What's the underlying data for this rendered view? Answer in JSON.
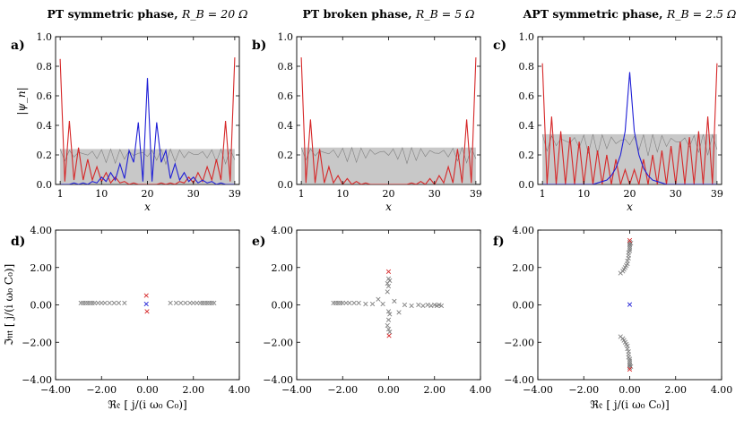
{
  "colors": {
    "red": "#d62728",
    "blue": "#1f1fd6",
    "gray": "#7f7f7f",
    "bulk_fill": "#9a9a9a"
  },
  "chart_data": [
    {
      "id": "a",
      "type": "line",
      "panel_label": "a)",
      "title": "PT symmetric phase, R_B = 20 Ω",
      "title_main": "PT symmetric phase, ",
      "title_math": "R_B = 20 Ω",
      "xlabel": "x",
      "ylabel": "|ψ_n|",
      "xlim": [
        0,
        40
      ],
      "ylim": [
        0,
        1
      ],
      "xticks": [
        1,
        10,
        20,
        30,
        39
      ],
      "yticks": [
        "0.0",
        "0.2",
        "0.4",
        "0.6",
        "0.8",
        "1.0"
      ],
      "bulk_band": {
        "color": "gray",
        "range": [
          0.0,
          0.24
        ]
      },
      "series": [
        {
          "color": "red",
          "x": [
            1,
            2,
            3,
            4,
            5,
            6,
            7,
            8,
            9,
            10,
            11,
            12,
            13,
            14,
            15,
            16,
            17,
            18,
            19,
            20,
            21,
            22,
            23,
            24,
            25,
            26,
            27,
            28,
            29,
            30,
            31,
            32,
            33,
            34,
            35,
            36,
            37,
            38,
            39
          ],
          "values": [
            0.85,
            0.02,
            0.43,
            0.03,
            0.25,
            0.03,
            0.17,
            0.03,
            0.12,
            0.02,
            0.08,
            0.01,
            0.05,
            0.01,
            0.02,
            0.0,
            0.01,
            0.0,
            0.0,
            0.0,
            0.0,
            0.0,
            0.01,
            0.0,
            0.01,
            0.0,
            0.02,
            0.01,
            0.05,
            0.01,
            0.08,
            0.02,
            0.12,
            0.03,
            0.17,
            0.03,
            0.43,
            0.02,
            0.86
          ]
        },
        {
          "color": "blue",
          "x": [
            1,
            2,
            3,
            4,
            5,
            6,
            7,
            8,
            9,
            10,
            11,
            12,
            13,
            14,
            15,
            16,
            17,
            18,
            19,
            20,
            21,
            22,
            23,
            24,
            25,
            26,
            27,
            28,
            29,
            30,
            31,
            32,
            33,
            34,
            35,
            36,
            37,
            38,
            39
          ],
          "values": [
            0.0,
            0.0,
            0.0,
            0.01,
            0.0,
            0.01,
            0.0,
            0.02,
            0.01,
            0.05,
            0.02,
            0.08,
            0.03,
            0.14,
            0.04,
            0.23,
            0.15,
            0.42,
            0.02,
            0.72,
            0.02,
            0.42,
            0.15,
            0.23,
            0.04,
            0.14,
            0.03,
            0.08,
            0.02,
            0.05,
            0.01,
            0.03,
            0.01,
            0.02,
            0.0,
            0.01,
            0.0,
            0.0,
            0.0
          ]
        }
      ]
    },
    {
      "id": "b",
      "type": "line",
      "panel_label": "b)",
      "title": "PT broken phase, R_B = 5 Ω",
      "title_main": "PT broken phase, ",
      "title_math": "R_B = 5 Ω",
      "xlabel": "x",
      "ylabel": "",
      "xlim": [
        0,
        40
      ],
      "ylim": [
        0,
        1
      ],
      "xticks": [
        1,
        10,
        20,
        30,
        39
      ],
      "yticks": [
        "0.0",
        "0.2",
        "0.4",
        "0.6",
        "0.8",
        "1.0"
      ],
      "bulk_band": {
        "color": "gray",
        "range": [
          0.0,
          0.25
        ]
      },
      "series": [
        {
          "color": "red",
          "x": [
            1,
            2,
            3,
            4,
            5,
            6,
            7,
            8,
            9,
            10,
            11,
            12,
            13,
            14,
            15,
            16,
            17,
            18,
            19,
            20,
            21,
            22,
            23,
            24,
            25,
            26,
            27,
            28,
            29,
            30,
            31,
            32,
            33,
            34,
            35,
            36,
            37,
            38,
            39
          ],
          "values": [
            0.86,
            0.01,
            0.44,
            0.01,
            0.24,
            0.01,
            0.12,
            0.01,
            0.06,
            0.0,
            0.04,
            0.0,
            0.02,
            0.0,
            0.01,
            0.0,
            0.0,
            0.0,
            0.0,
            0.0,
            0.0,
            0.0,
            0.0,
            0.0,
            0.01,
            0.0,
            0.02,
            0.0,
            0.04,
            0.0,
            0.06,
            0.01,
            0.12,
            0.01,
            0.24,
            0.01,
            0.44,
            0.01,
            0.86
          ]
        }
      ]
    },
    {
      "id": "c",
      "type": "line",
      "panel_label": "c)",
      "title": "APT symmetric phase, R_B = 2.5 Ω",
      "title_main": "APT symmetric phase, ",
      "title_math": "R_B = 2.5 Ω",
      "xlabel": "x",
      "ylabel": "",
      "xlim": [
        0,
        40
      ],
      "ylim": [
        0,
        1
      ],
      "xticks": [
        1,
        10,
        20,
        30,
        39
      ],
      "yticks": [
        "0.0",
        "0.2",
        "0.4",
        "0.6",
        "0.8",
        "1.0"
      ],
      "bulk_band": {
        "color": "gray",
        "range": [
          0.0,
          0.34
        ]
      },
      "series": [
        {
          "color": "red",
          "x": [
            1,
            2,
            3,
            4,
            5,
            6,
            7,
            8,
            9,
            10,
            11,
            12,
            13,
            14,
            15,
            16,
            17,
            18,
            19,
            20,
            21,
            22,
            23,
            24,
            25,
            26,
            27,
            28,
            29,
            30,
            31,
            32,
            33,
            34,
            35,
            36,
            37,
            38,
            39
          ],
          "values": [
            0.82,
            0.0,
            0.46,
            0.0,
            0.36,
            0.0,
            0.32,
            0.0,
            0.29,
            0.0,
            0.26,
            0.0,
            0.23,
            0.0,
            0.2,
            0.0,
            0.17,
            0.0,
            0.1,
            0.0,
            0.1,
            0.0,
            0.17,
            0.0,
            0.2,
            0.0,
            0.23,
            0.0,
            0.26,
            0.0,
            0.29,
            0.0,
            0.32,
            0.0,
            0.36,
            0.0,
            0.46,
            0.0,
            0.82
          ]
        },
        {
          "color": "blue",
          "x": [
            1,
            2,
            3,
            4,
            5,
            6,
            7,
            8,
            9,
            10,
            11,
            12,
            13,
            14,
            15,
            16,
            17,
            18,
            19,
            20,
            21,
            22,
            23,
            24,
            25,
            26,
            27,
            28,
            29,
            30,
            31,
            32,
            33,
            34,
            35,
            36,
            37,
            38,
            39
          ],
          "values": [
            0.0,
            0.0,
            0.0,
            0.0,
            0.0,
            0.0,
            0.0,
            0.0,
            0.0,
            0.0,
            0.0,
            0.0,
            0.01,
            0.02,
            0.03,
            0.06,
            0.11,
            0.2,
            0.36,
            0.76,
            0.36,
            0.2,
            0.11,
            0.06,
            0.03,
            0.02,
            0.01,
            0.0,
            0.0,
            0.0,
            0.0,
            0.0,
            0.0,
            0.0,
            0.0,
            0.0,
            0.0,
            0.0,
            0.0
          ]
        }
      ]
    },
    {
      "id": "d",
      "type": "scatter",
      "panel_label": "d)",
      "xlabel": "ℜ𝔢 [ j/(i ω₀ C₀)]",
      "ylabel": "ℑ𝔪 [ j/(i ω₀ C₀)]",
      "xlim": [
        -4,
        4
      ],
      "ylim": [
        -4,
        4
      ],
      "xticks": [
        "−4.00",
        "−2.00",
        "0.00",
        "2.00",
        "4.00"
      ],
      "yticks": [
        "−4.00",
        "−2.00",
        "0.00",
        "2.00",
        "4.00"
      ],
      "series": [
        {
          "color": "gray",
          "marker": "x",
          "x": [
            -2.9,
            -2.8,
            -2.7,
            -2.6,
            -2.5,
            -2.4,
            -2.3,
            -2.15,
            -2.0,
            -1.85,
            -1.65,
            -1.45,
            -1.25,
            -1.0,
            1.0,
            1.25,
            1.45,
            1.65,
            1.85,
            2.0,
            2.15,
            2.3,
            2.4,
            2.5,
            2.6,
            2.7,
            2.8,
            2.9
          ],
          "y": [
            0.1,
            0.1,
            0.1,
            0.1,
            0.1,
            0.1,
            0.1,
            0.1,
            0.1,
            0.1,
            0.1,
            0.1,
            0.1,
            0.1,
            0.1,
            0.1,
            0.1,
            0.1,
            0.1,
            0.1,
            0.1,
            0.1,
            0.1,
            0.1,
            0.1,
            0.1,
            0.1,
            0.1
          ]
        },
        {
          "color": "red",
          "marker": "x",
          "x": [
            -0.05,
            -0.02
          ],
          "y": [
            0.5,
            -0.35
          ]
        },
        {
          "color": "blue",
          "marker": "x",
          "x": [
            -0.05
          ],
          "y": [
            0.05
          ]
        }
      ]
    },
    {
      "id": "e",
      "type": "scatter",
      "panel_label": "e)",
      "xlabel": "",
      "ylabel": "",
      "xlim": [
        -4,
        4
      ],
      "ylim": [
        -4,
        4
      ],
      "xticks": [
        "−4.00",
        "−2.00",
        "0.00",
        "2.00",
        "4.00"
      ],
      "yticks": [
        "−4.00",
        "−2.00",
        "0.00",
        "2.00",
        "4.00"
      ],
      "series": [
        {
          "color": "gray",
          "marker": "x",
          "x": [
            -2.4,
            -2.3,
            -2.2,
            -2.1,
            -2.0,
            -1.85,
            -1.7,
            -1.5,
            -1.3,
            -1.0,
            -0.7,
            -0.45,
            -0.25,
            -0.05,
            0.0,
            0.05,
            0.0,
            -0.05,
            0.0,
            0.05,
            0.0,
            -0.05,
            0.0,
            0.05,
            0.25,
            0.45,
            0.7,
            1.0,
            1.3,
            1.5,
            1.7,
            1.85,
            2.0,
            2.1,
            2.2,
            2.3
          ],
          "y": [
            0.1,
            0.1,
            0.1,
            0.1,
            0.1,
            0.1,
            0.1,
            0.1,
            0.1,
            0.05,
            0.05,
            0.3,
            0.05,
            0.7,
            1.0,
            1.3,
            1.4,
            1.15,
            -0.35,
            -0.5,
            -0.8,
            -1.1,
            -1.3,
            -1.45,
            0.2,
            -0.4,
            0.0,
            -0.05,
            0.0,
            -0.05,
            0.0,
            -0.05,
            0.0,
            -0.05,
            0.0,
            -0.05
          ]
        },
        {
          "color": "red",
          "marker": "x",
          "x": [
            0.0,
            0.02
          ],
          "y": [
            1.78,
            -1.65
          ]
        }
      ]
    },
    {
      "id": "f",
      "type": "scatter",
      "panel_label": "f)",
      "xlabel": "ℜ𝔢 [ j/(i ω₀ C₀)]",
      "ylabel": "",
      "xlim": [
        -4,
        4
      ],
      "ylim": [
        -4,
        4
      ],
      "xticks": [
        "−4.00",
        "−2.00",
        "0.00",
        "2.00",
        "4.00"
      ],
      "yticks": [
        "−4.00",
        "−2.00",
        "0.00",
        "2.00",
        "4.00"
      ],
      "series": [
        {
          "color": "gray",
          "marker": "x",
          "x": [
            -0.4,
            -0.3,
            -0.25,
            -0.2,
            -0.15,
            -0.1,
            -0.1,
            -0.05,
            -0.05,
            -0.05,
            0.0,
            0.0,
            0.0,
            0.0,
            0.0,
            0.05,
            0.0,
            -0.4,
            -0.3,
            -0.25,
            -0.2,
            -0.15,
            -0.1,
            -0.1,
            -0.05,
            -0.05,
            -0.05,
            0.0,
            0.0,
            0.0,
            0.0,
            0.0,
            0.05,
            0.0
          ],
          "y": [
            1.7,
            1.8,
            1.9,
            2.0,
            2.1,
            2.2,
            2.35,
            2.5,
            2.65,
            2.8,
            2.9,
            3.0,
            3.1,
            3.2,
            3.25,
            3.3,
            3.35,
            -1.7,
            -1.8,
            -1.9,
            -2.0,
            -2.1,
            -2.2,
            -2.35,
            -2.5,
            -2.65,
            -2.8,
            -2.9,
            -3.0,
            -3.1,
            -3.2,
            -3.25,
            -3.3,
            -3.35
          ]
        },
        {
          "color": "red",
          "marker": "x",
          "x": [
            0.0,
            0.0
          ],
          "y": [
            3.45,
            -3.45
          ]
        },
        {
          "color": "blue",
          "marker": "x",
          "x": [
            0.0
          ],
          "y": [
            0.02
          ]
        }
      ]
    }
  ]
}
